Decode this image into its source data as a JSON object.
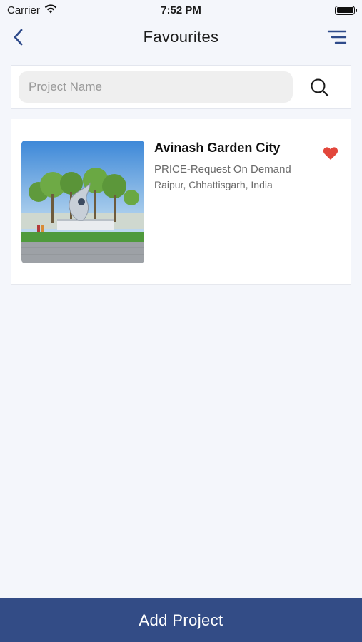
{
  "status_bar": {
    "carrier": "Carrier",
    "time": "7:52 PM",
    "icons": [
      "wifi-icon",
      "battery-icon"
    ]
  },
  "nav": {
    "title": "Favourites",
    "back_icon": "chevron-left-icon",
    "menu_icon": "menu-icon"
  },
  "search": {
    "placeholder": "Project Name",
    "value": "",
    "icon": "search-icon"
  },
  "favourites": [
    {
      "name": "Avinash Garden City",
      "price": "PRICE-Request On Demand",
      "location": "Raipur, Chhattisgarh, India",
      "favourited": true,
      "image": "project-thumbnail-garden-entrance"
    }
  ],
  "footer": {
    "add_project_label": "Add Project"
  },
  "colors": {
    "accent": "#334c86",
    "heart": "#e2463b",
    "background": "#f4f6fb"
  }
}
